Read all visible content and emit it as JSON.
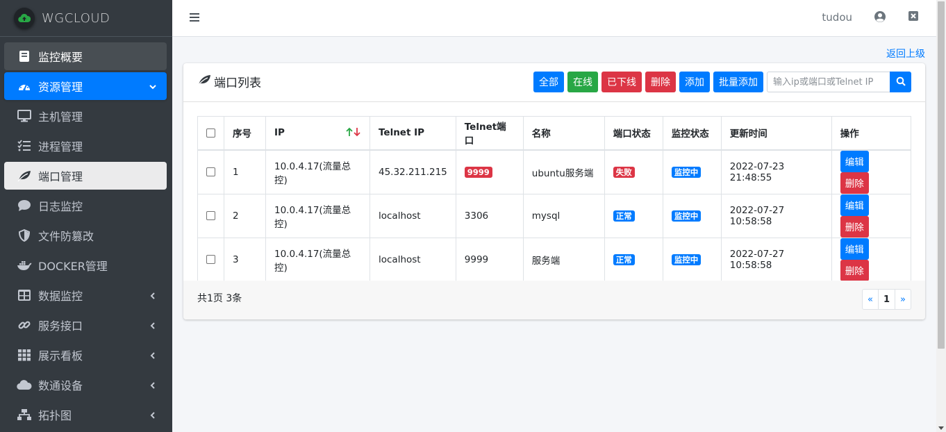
{
  "brand": {
    "name": "WGCLOUD"
  },
  "sidebar": {
    "items": [
      {
        "label": "监控概要",
        "icon": "book-icon"
      },
      {
        "label": "资源管理",
        "icon": "dashboard-icon"
      },
      {
        "label": "主机管理",
        "icon": "desktop-icon"
      },
      {
        "label": "进程管理",
        "icon": "tasks-icon"
      },
      {
        "label": "端口管理",
        "icon": "leaf-icon"
      },
      {
        "label": "日志监控",
        "icon": "comment-icon"
      },
      {
        "label": "文件防篡改",
        "icon": "shield-icon"
      },
      {
        "label": "DOCKER管理",
        "icon": "docker-icon"
      },
      {
        "label": "数据监控",
        "icon": "table-icon"
      },
      {
        "label": "服务接口",
        "icon": "link-icon"
      },
      {
        "label": "展示看板",
        "icon": "grid-icon"
      },
      {
        "label": "数通设备",
        "icon": "cloud-icon"
      },
      {
        "label": "拓扑图",
        "icon": "sitemap-icon"
      }
    ]
  },
  "topbar": {
    "username": "tudou"
  },
  "content": {
    "back_link": "返回上级"
  },
  "card": {
    "title": "端口列表",
    "buttons": {
      "all": "全部",
      "online": "在线",
      "offline": "已下线",
      "delete": "删除",
      "add": "添加",
      "batch_add": "批量添加"
    },
    "search_placeholder": "输入ip或端口或Telnet IP"
  },
  "table": {
    "headers": {
      "seq": "序号",
      "ip": "IP",
      "telnet_ip": "Telnet IP",
      "telnet_port": "Telnet端口",
      "name": "名称",
      "port_status": "端口状态",
      "monitor_status": "监控状态",
      "updated": "更新时间",
      "actions": "操作"
    },
    "rows": [
      {
        "seq": "1",
        "ip": "10.0.4.17(流量总控)",
        "telnet_ip": "45.32.211.215",
        "telnet_port": "9999",
        "name": "ubuntu服务端",
        "port_status": "失败",
        "monitor_status": "监控中",
        "updated": "2022-07-23 21:48:55",
        "edit": "编辑",
        "delete": "删除"
      },
      {
        "seq": "2",
        "ip": "10.0.4.17(流量总控)",
        "telnet_ip": "localhost",
        "telnet_port": "3306",
        "name": "mysql",
        "port_status": "正常",
        "monitor_status": "监控中",
        "updated": "2022-07-27 10:58:58",
        "edit": "编辑",
        "delete": "删除"
      },
      {
        "seq": "3",
        "ip": "10.0.4.17(流量总控)",
        "telnet_ip": "localhost",
        "telnet_port": "9999",
        "name": "服务端",
        "port_status": "正常",
        "monitor_status": "监控中",
        "updated": "2022-07-27 10:58:58",
        "edit": "编辑",
        "delete": "删除"
      }
    ]
  },
  "footer": {
    "total": "共1页 3条",
    "pager": {
      "prev": "«",
      "current": "1",
      "next": "»"
    }
  },
  "colors": {
    "primary": "#007bff",
    "success": "#28a745",
    "danger": "#dc3545",
    "sidebar": "#343a40"
  }
}
